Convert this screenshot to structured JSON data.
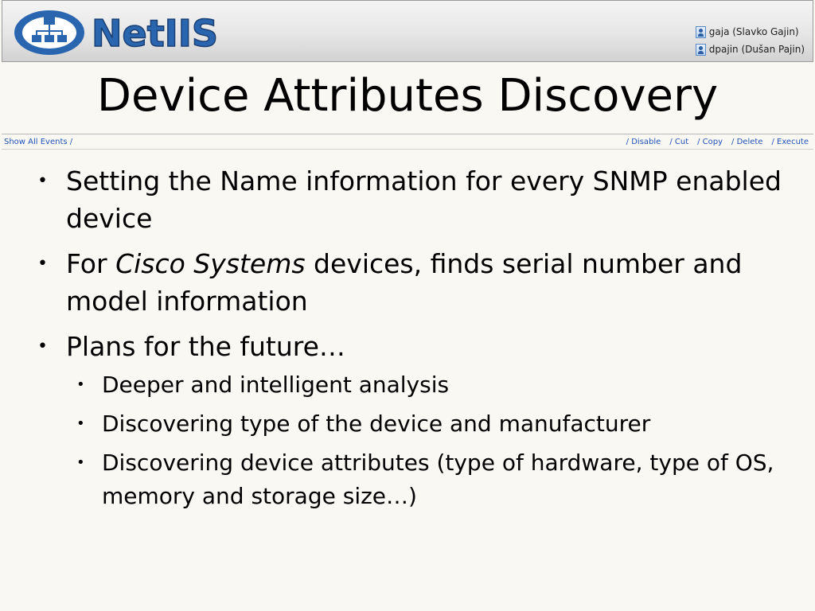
{
  "header": {
    "logo_text": "NetIIS",
    "users": [
      {
        "label": "gaja (Slavko Gajin)"
      },
      {
        "label": "dpajin (Dušan Pajin)"
      }
    ]
  },
  "title": "Device Attributes Discovery",
  "toolbar": {
    "left_link": "Show All Events /",
    "actions": [
      "/ Disable",
      "/ Cut",
      "/ Copy",
      "/ Delete",
      "/ Execute"
    ]
  },
  "bullets": {
    "b1": "Setting the Name information for every SNMP enabled device",
    "b2_prefix": "For ",
    "b2_italic": "Cisco Systems",
    "b2_suffix": " devices, finds serial number and model information",
    "b3": "Plans for the future…",
    "sub": [
      "Deeper and intelligent analysis",
      "Discovering type of the device and manufacturer",
      "Discovering device attributes (type of hardware, type of OS, memory and storage size…)"
    ]
  },
  "icons": {
    "logo": "network-hierarchy-icon",
    "user": "user-icon",
    "bullet": "bullet-dot"
  },
  "colors": {
    "logo_blue": "#2a66b0",
    "link_blue": "#1e53b8",
    "background": "#faf8f3"
  }
}
